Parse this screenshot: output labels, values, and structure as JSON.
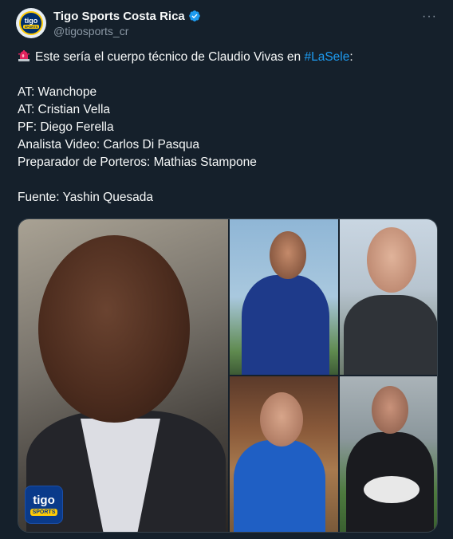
{
  "account": {
    "display_name": "Tigo Sports Costa Rica",
    "handle": "@tigosports_cr",
    "avatar_text": "tigo",
    "avatar_sub": "SPORTS",
    "verified_color": "#1d9bf0"
  },
  "more_icon": "···",
  "tweet": {
    "intro_text": "Este sería el cuerpo técnico de Claudio Vivas en ",
    "hashtag": "#LaSele",
    "intro_suffix": ":",
    "lines": [
      "AT: Wanchope",
      "AT: Cristian Vella",
      "PF: Diego Ferella",
      "Analista Video: Carlos Di Pasqua",
      "Preparador de Porteros: Mathias Stampone"
    ],
    "source_line": "Fuente: Yashin Quesada"
  },
  "media": {
    "badge_text": "tigo",
    "badge_sub": "SPORTS"
  },
  "colors": {
    "background": "#15202b",
    "text": "#f7f9f9",
    "secondary": "#8b98a5",
    "link": "#1d9bf0"
  }
}
